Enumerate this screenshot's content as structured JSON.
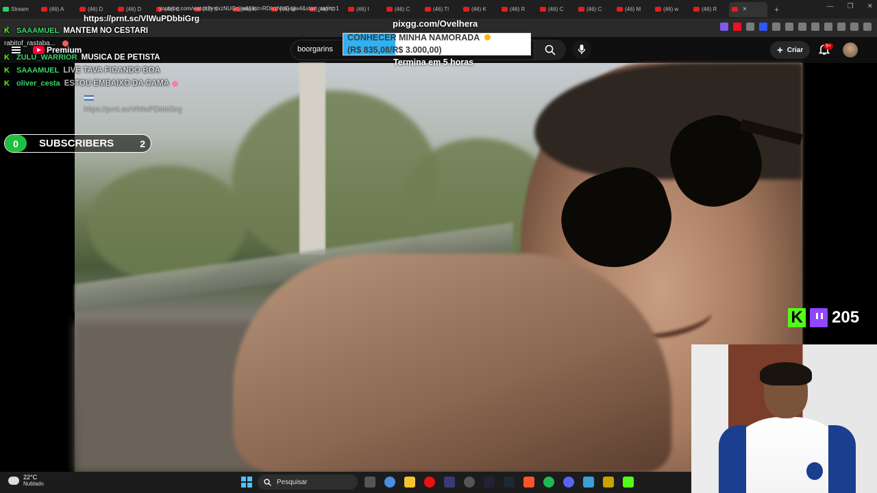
{
  "browser": {
    "tabs": [
      {
        "label": "Stream",
        "favicon": "kick-icon",
        "active": false
      },
      {
        "label": "(46) A",
        "favicon": "youtube-icon",
        "active": false
      },
      {
        "label": "(46) D",
        "favicon": "youtube-icon",
        "active": false
      },
      {
        "label": "(46) D",
        "favicon": "youtube-icon",
        "active": false
      },
      {
        "label": "(46) C",
        "favicon": "youtube-icon",
        "active": false
      },
      {
        "label": "(46) S",
        "favicon": "youtube-icon",
        "active": false
      },
      {
        "label": "(46) K",
        "favicon": "youtube-icon",
        "active": false
      },
      {
        "label": "(46) M",
        "favicon": "youtube-icon",
        "active": false
      },
      {
        "label": "(46) \"C",
        "favicon": "youtube-icon",
        "active": false
      },
      {
        "label": "(46) I",
        "favicon": "youtube-icon",
        "active": false
      },
      {
        "label": "(46) C",
        "favicon": "youtube-icon",
        "active": false
      },
      {
        "label": "(46) Tl",
        "favicon": "youtube-icon",
        "active": false
      },
      {
        "label": "(46) K",
        "favicon": "youtube-icon",
        "active": false
      },
      {
        "label": "(46) R",
        "favicon": "youtube-icon",
        "active": false
      },
      {
        "label": "(46) C",
        "favicon": "youtube-icon",
        "active": false
      },
      {
        "label": "(46) C",
        "favicon": "youtube-icon",
        "active": false
      },
      {
        "label": "(46) M",
        "favicon": "youtube-icon",
        "active": false
      },
      {
        "label": "(46) w",
        "favicon": "youtube-icon",
        "active": false
      },
      {
        "label": "(46) R",
        "favicon": "youtube-icon",
        "active": false
      },
      {
        "label": "",
        "favicon": "youtube-icon",
        "active": true
      }
    ],
    "url": "youtube.com/watch?v=lxzNUGcjjw4&list=RDlxzNUGcjjw4&start_radio=1",
    "new_tab_label": "+"
  },
  "youtube": {
    "logo_text": "Premium",
    "search_value": "boorgarins",
    "create_label": "Criar",
    "notification_badge": "9+"
  },
  "chat": {
    "top_link": "https://prnt.sc/VlWuPDbbiGrg",
    "messages": [
      {
        "user": "SAAAMUEL",
        "text": "MANTEM NO CESTARI",
        "faded": false
      },
      {
        "user": "rabitof_rastaba...",
        "text": "",
        "faded": false
      },
      {
        "user": "ZULU_WARRIOR",
        "text": "MUSICA DE PETISTA",
        "faded": false
      },
      {
        "user": "SAAAMUEL",
        "text": "LIVE TAVA FICANDO BOA",
        "faded": true
      },
      {
        "user": "oliver_cesta",
        "text": "ESTOU EMBAIXO DA CAMA",
        "faded": true
      }
    ],
    "faded_link": "https://prnt.sc/VlWuPDbbiGrg"
  },
  "subscribers": {
    "count": "0",
    "label": "SUBSCRIBERS",
    "goal": "2"
  },
  "pix": {
    "title": "pixgg.com/Ovelhera",
    "goal_name": "CONHECER MINHA NAMORADA",
    "goal_amount": "(R$ 835,08/R$ 3.000,00)",
    "progress": 0.278,
    "time_left": "Termina em 5 horas",
    "fill_color": "#2fb1f2"
  },
  "viewers": {
    "count": "205",
    "kick_color": "#53fc18",
    "twitch_color": "#9146ff"
  },
  "taskbar": {
    "weather_temp": "22°C",
    "weather_desc": "Nublado",
    "search_label": "Pesquisar",
    "icons": [
      "windows-start-icon",
      "task-view-icon",
      "chrome-icon",
      "file-explorer-icon",
      "opera-icon",
      "app-icon",
      "obs-icon",
      "app-arrow-icon",
      "steam-icon",
      "brave-icon",
      "spotify-icon",
      "discord-icon",
      "notepad-icon",
      "app-icon",
      "kick-app-icon"
    ]
  }
}
